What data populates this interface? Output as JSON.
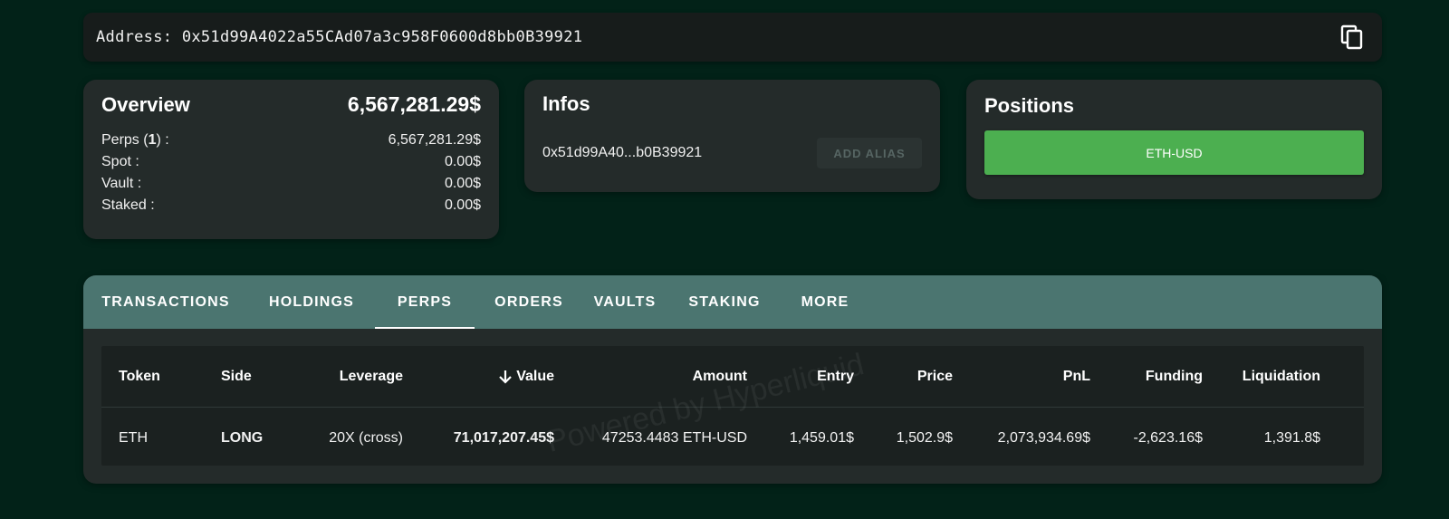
{
  "address_bar": {
    "label": "Address: 0x51d99A4022a55CAd07a3c958F0600d8bb0B39921",
    "copy_icon": "copy-icon"
  },
  "overview": {
    "title": "Overview",
    "total": "6,567,281.29$",
    "rows": [
      {
        "label_prefix": "Perps (",
        "label_bold": "1",
        "label_suffix": ") :",
        "value": "6,567,281.29$"
      },
      {
        "label": "Spot :",
        "value": "0.00$"
      },
      {
        "label": "Vault :",
        "value": "0.00$"
      },
      {
        "label": "Staked :",
        "value": "0.00$"
      }
    ]
  },
  "infos": {
    "title": "Infos",
    "short_address": "0x51d99A40...b0B39921",
    "add_alias_label": "ADD ALIAS"
  },
  "positions": {
    "title": "Positions",
    "items": [
      "ETH-USD"
    ],
    "button_color": "#4caf50"
  },
  "tabs": [
    {
      "label": "TRANSACTIONS"
    },
    {
      "label": "HOLDINGS"
    },
    {
      "label": "PERPS",
      "active": true
    },
    {
      "label": "ORDERS"
    },
    {
      "label": "VAULTS"
    },
    {
      "label": "STAKING"
    },
    {
      "label": "MORE"
    }
  ],
  "table": {
    "headers": {
      "token": "Token",
      "side": "Side",
      "leverage": "Leverage",
      "value": "Value",
      "amount": "Amount",
      "entry": "Entry",
      "price": "Price",
      "pnl": "PnL",
      "funding": "Funding",
      "liquidation": "Liquidation"
    },
    "sort_icon": "arrow-down-icon",
    "rows": [
      {
        "token": "ETH",
        "side": "LONG",
        "leverage": "20X (cross)",
        "value": "71,017,207.45$",
        "amount": "47253.4483 ETH-USD",
        "entry": "1,459.01$",
        "price": "1,502.9$",
        "pnl": "2,073,934.69$",
        "funding": "-2,623.16$",
        "liquidation": "1,391.8$"
      }
    ]
  },
  "watermark": "Powered by Hyperliquid",
  "colors": {
    "background": "#022218",
    "card": "#242b2a",
    "tabs_bar": "#4b7570",
    "long": "#1b9e2d",
    "pnl_positive": "#15862a",
    "funding_negative": "#ff2d2d"
  }
}
